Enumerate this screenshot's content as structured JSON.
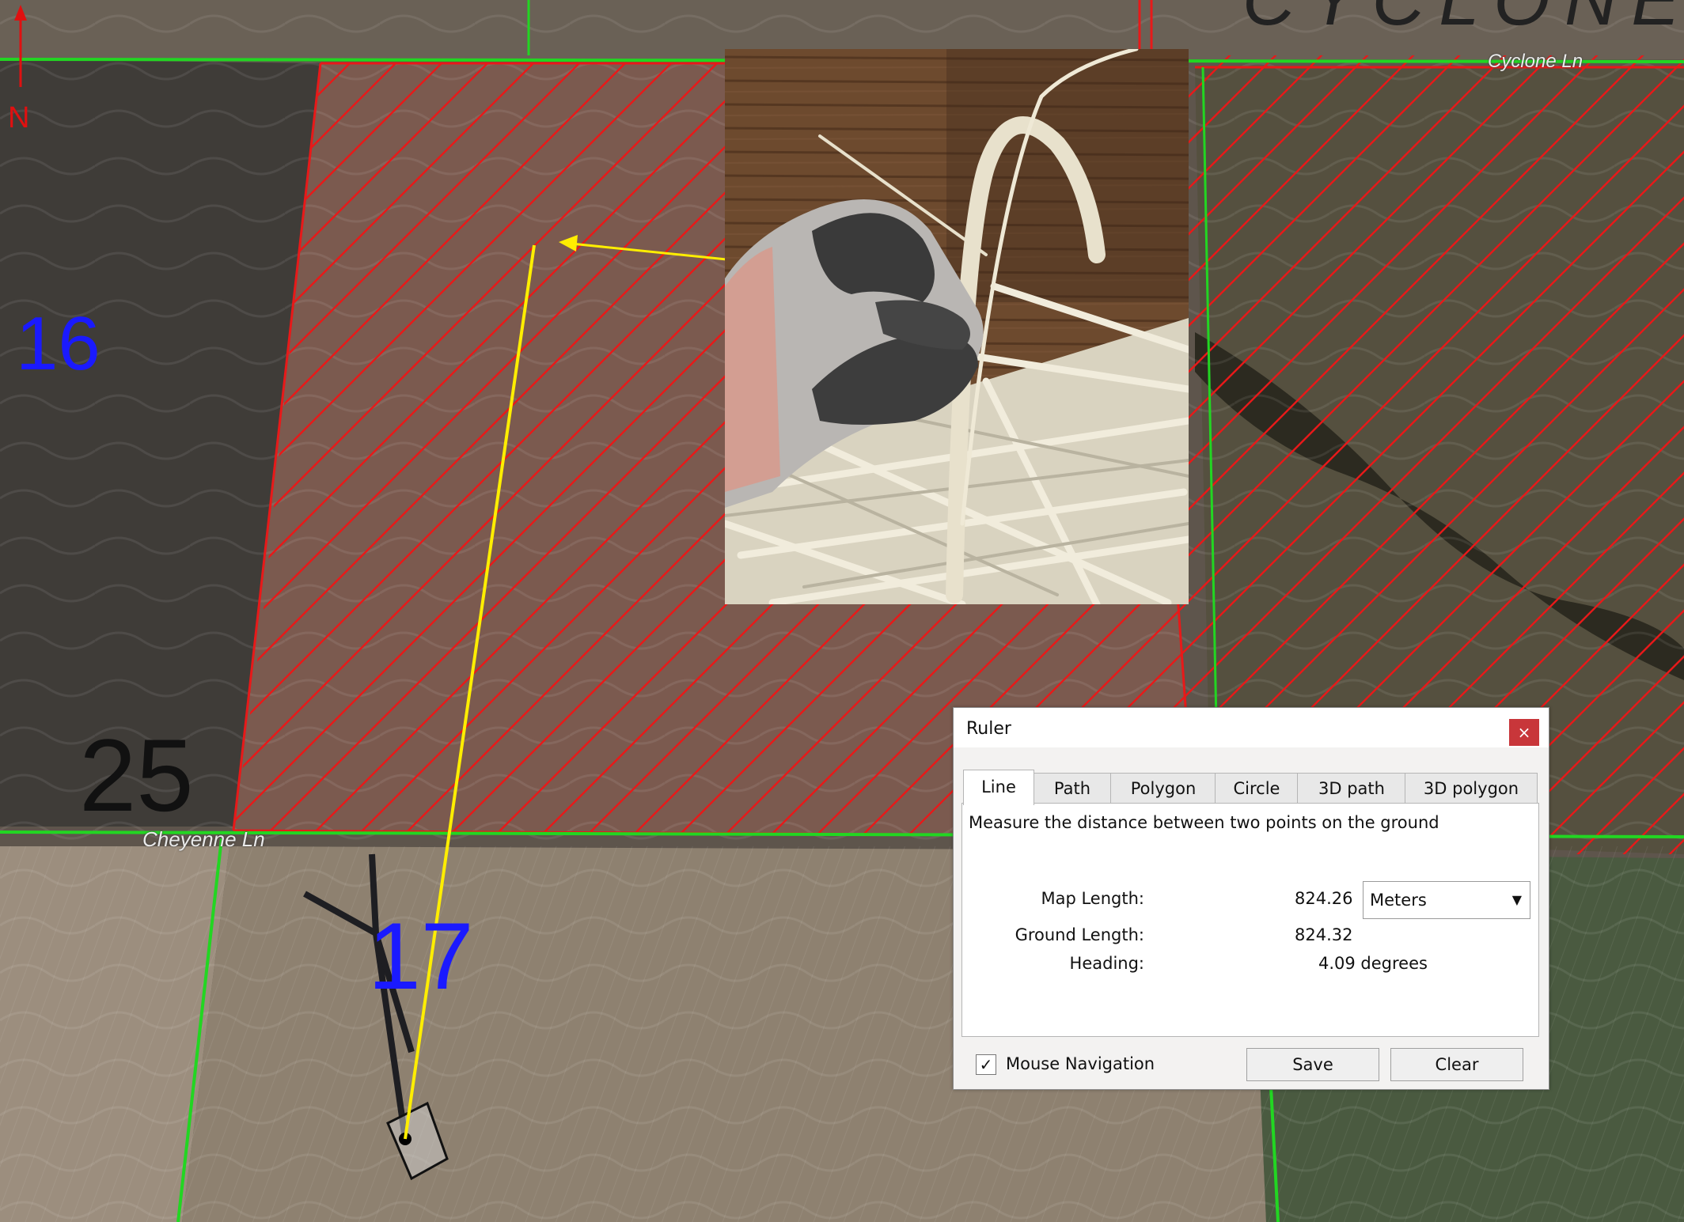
{
  "map": {
    "north_label": "N",
    "section_labels": {
      "sec16": "16",
      "sec17": "17",
      "sec25": "25",
      "cyclone_text": "CYCLONE"
    },
    "road_labels": {
      "cheyenne": "Cheyenne Ln",
      "cyclone": "Cyclone Ln"
    },
    "colors": {
      "hatch": "#e81919",
      "boundary_green": "#22d622",
      "measure_line": "#ffee00",
      "north_arrow": "#e01010"
    }
  },
  "ruler": {
    "title": "Ruler",
    "close_label": "×",
    "tabs": [
      "Line",
      "Path",
      "Polygon",
      "Circle",
      "3D path",
      "3D polygon"
    ],
    "active_tab": "Line",
    "description": "Measure the distance between two points on the ground",
    "map_length_label": "Map Length:",
    "map_length_value": "824.26",
    "unit_selected": "Meters",
    "ground_length_label": "Ground Length:",
    "ground_length_value": "824.32",
    "heading_label": "Heading:",
    "heading_value": "4.09 degrees",
    "mouse_navigation_label": "Mouse Navigation",
    "mouse_navigation_checked": "✓",
    "save_label": "Save",
    "clear_label": "Clear"
  }
}
